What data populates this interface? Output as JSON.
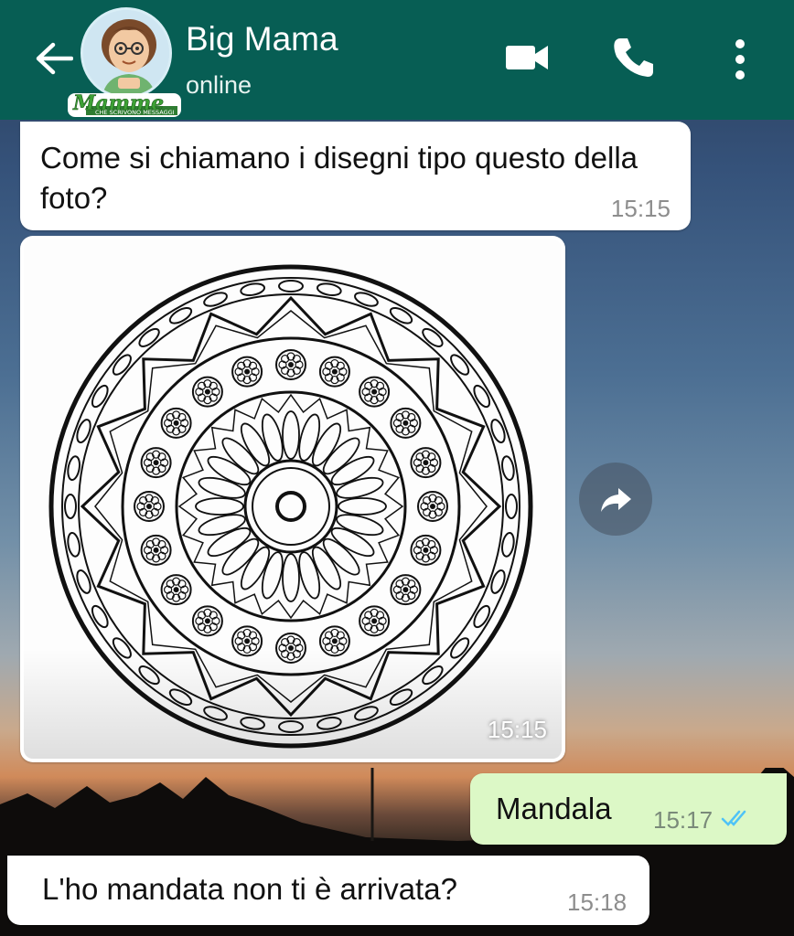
{
  "header": {
    "contact_name": "Big Mama",
    "status": "online",
    "logo_text": "Mamme",
    "logo_subtext": "CHE SCRIVONO MESSAGGI"
  },
  "icons": {
    "back": "arrow-left-icon",
    "video": "video-camera-icon",
    "call": "phone-icon",
    "menu": "more-vertical-icon",
    "forward": "forward-icon",
    "read_receipt": "double-check-icon"
  },
  "colors": {
    "header_bg": "#075e54",
    "incoming_bubble": "#ffffff",
    "outgoing_bubble": "#dcf8c6",
    "read_ticks": "#4fc3f7"
  },
  "messages": [
    {
      "direction": "incoming",
      "type": "text",
      "text": "Come si chiamano i disegni tipo questo della foto?",
      "time": "15:15"
    },
    {
      "direction": "incoming",
      "type": "image",
      "image_description": "mandala-coloring-drawing",
      "time": "15:15"
    },
    {
      "direction": "outgoing",
      "type": "text",
      "text": "Mandala",
      "time": "15:17",
      "status": "read"
    },
    {
      "direction": "incoming",
      "type": "text",
      "text": "L'ho mandata non ti è arrivata?",
      "time": "15:18"
    }
  ]
}
